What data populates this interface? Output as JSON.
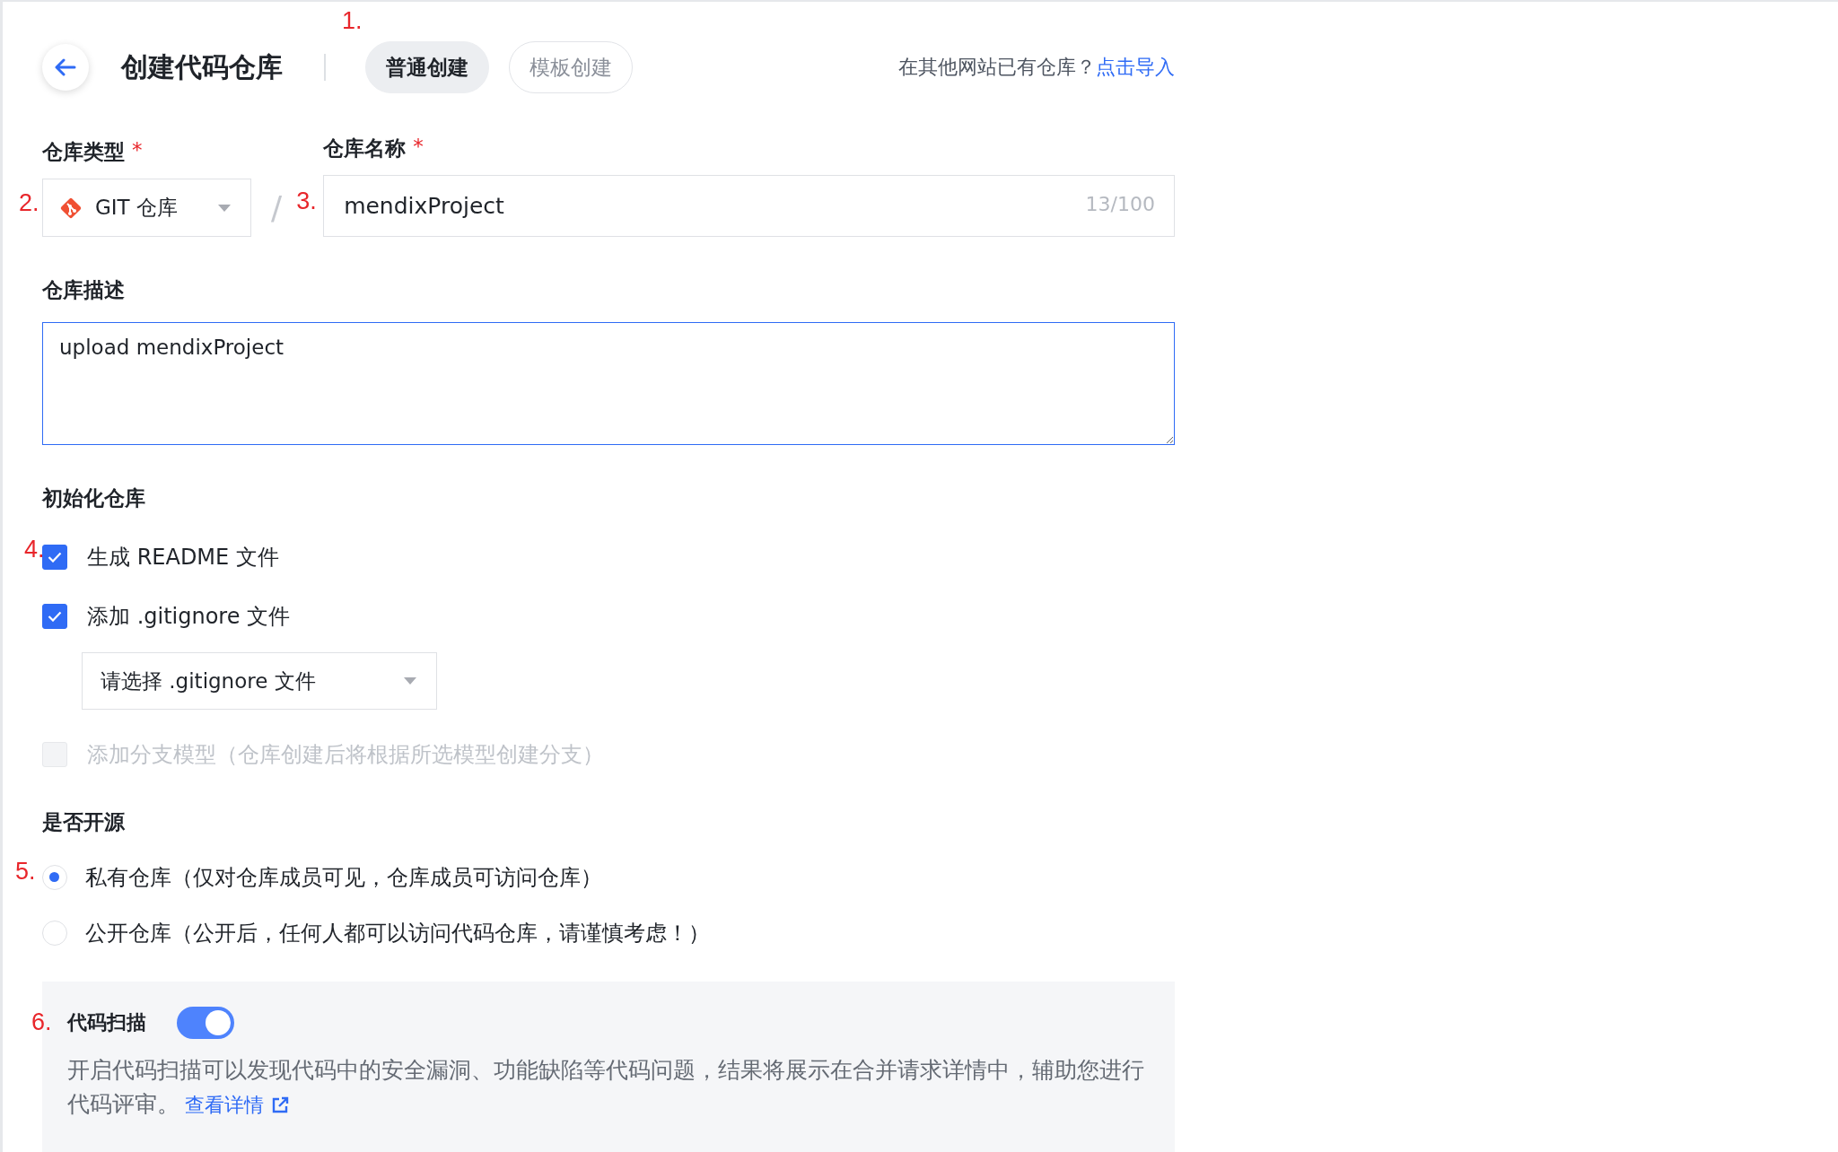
{
  "header": {
    "title": "创建代码仓库",
    "annotation": "1.",
    "tabs": [
      {
        "label": "普通创建",
        "selected": true
      },
      {
        "label": "模板创建",
        "selected": false
      }
    ],
    "import_prompt": "在其他网站已有仓库？",
    "import_link": "点击导入"
  },
  "repo_type": {
    "label": "仓库类型",
    "required_mark": "*",
    "value": "GIT 仓库",
    "annotation": "2."
  },
  "separator": "/",
  "repo_name": {
    "label": "仓库名称",
    "required_mark": "*",
    "value": "mendixProject",
    "counter": "13/100",
    "annotation": "3."
  },
  "description": {
    "label": "仓库描述",
    "value": "upload mendixProject",
    "focused": true
  },
  "init": {
    "label": "初始化仓库",
    "items": [
      {
        "kind": "checkbox",
        "label": "生成 README 文件",
        "checked": true,
        "disabled": false,
        "annotation": "4."
      },
      {
        "kind": "checkbox",
        "label": "添加 .gitignore 文件",
        "checked": true,
        "disabled": false
      },
      {
        "kind": "select",
        "placeholder": "请选择 .gitignore 文件"
      },
      {
        "kind": "checkbox",
        "label": "添加分支模型（仓库创建后将根据所选模型创建分支）",
        "checked": false,
        "disabled": true
      }
    ]
  },
  "visibility": {
    "label": "是否开源",
    "options": [
      {
        "label": "私有仓库（仅对仓库成员可见，仓库成员可访问仓库）",
        "selected": true,
        "annotation": "5."
      },
      {
        "label": "公开仓库（公开后，任何人都可以访问代码仓库，请谨慎考虑！）",
        "selected": false
      }
    ]
  },
  "code_scan": {
    "label": "代码扫描",
    "on": true,
    "annotation": "6.",
    "description": "开启代码扫描可以发现代码中的安全漏洞、功能缺陷等代码问题，结果将展示在合并请求详情中，辅助您进行代码评审。",
    "link": "查看详情"
  }
}
